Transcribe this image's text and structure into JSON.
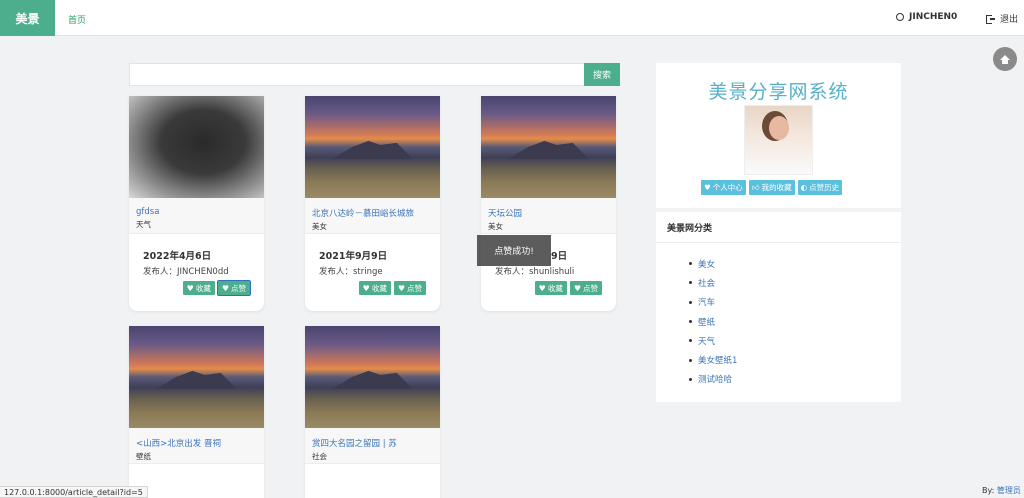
{
  "nav": {
    "brand": "美景",
    "home": "首页",
    "username": "JINCHEN0",
    "logout": "退出"
  },
  "search": {
    "button": "搜索",
    "placeholder": ""
  },
  "cards": [
    {
      "title": "gfdsa",
      "category": "天气",
      "date": "2022年4月6日",
      "publisher": "发布人：JINCHEN0dd",
      "collect": "收藏",
      "like": "点赞"
    },
    {
      "title": "北京八达岭－慕田峪长城旅",
      "category": "美女",
      "date": "2021年9月9日",
      "publisher": "发布人：stringe",
      "collect": "收藏",
      "like": "点赞"
    },
    {
      "title": "天坛公园",
      "category": "美女",
      "date": "9日",
      "publisher": "发布人：shunlishuli",
      "collect": "收藏",
      "like": "点赞"
    },
    {
      "title": "<山西>北京出发 晋祠",
      "category": "壁纸"
    },
    {
      "title": "赏四大名园之留园 | 苏",
      "category": "社会"
    }
  ],
  "toast": "点赞成功!",
  "sidebar": {
    "site_title": "美景分享网系统",
    "buttons": [
      "个人中心",
      "我的收藏",
      "点赞历史"
    ],
    "category_heading": "美景网分类",
    "categories": [
      "美女",
      "社会",
      "汽车",
      "壁纸",
      "天气",
      "美女壁纸1",
      "测试哈哈"
    ]
  },
  "status_url": "127.0.0.1:8000/article_detail?id=5",
  "footer": {
    "by": "By:",
    "admin": "管理员"
  },
  "colors": {
    "primary": "#4cae8c",
    "info": "#5bc0de",
    "link": "#3b73b9"
  }
}
